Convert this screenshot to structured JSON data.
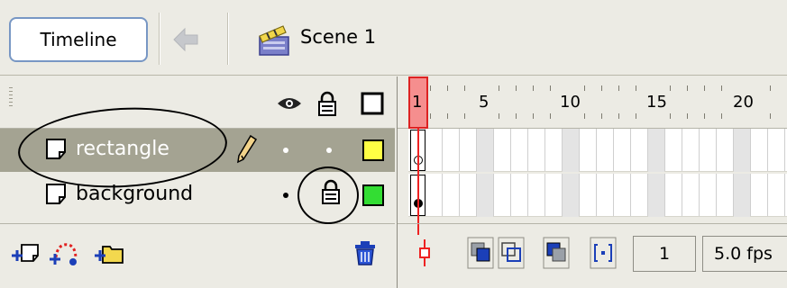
{
  "toolbar": {
    "timeline_tab": "Timeline",
    "scene_label": "Scene 1"
  },
  "layer_header": {
    "eye_icon": "eye-icon",
    "lock_icon": "lock-icon",
    "outline_icon": "outline-icon"
  },
  "layers": [
    {
      "name": "rectangle",
      "color": "#ffff44",
      "selected": true,
      "editing_icon": "pencil-icon"
    },
    {
      "name": "background",
      "color": "#33dd33",
      "selected": false,
      "locked": true
    }
  ],
  "ruler": {
    "labels": [
      "1",
      "5",
      "10",
      "15",
      "20"
    ]
  },
  "frames_footer": {
    "current_frame": "1",
    "frame_rate": "5.0 fps"
  },
  "colors": {
    "selected_row": "#a4a392",
    "playhead": "#e22222",
    "panel_bg": "#ecebe4"
  }
}
